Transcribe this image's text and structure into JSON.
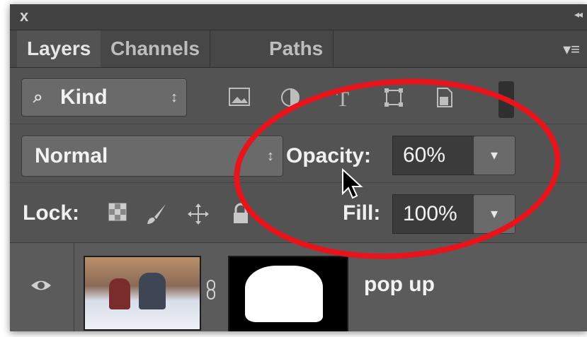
{
  "window": {
    "close_glyph": "x",
    "collapse_glyph": "◂◂"
  },
  "tabs": [
    {
      "label": "Layers",
      "active": true
    },
    {
      "label": "Channels",
      "active": false
    },
    {
      "label": "Paths",
      "active": false
    }
  ],
  "panel_menu_glyph": "▾≡",
  "filter": {
    "label": "Kind",
    "search_glyph": "⌕",
    "arrows": "↕"
  },
  "filter_icons": [
    "pixel-layer-filter-icon",
    "adjustment-layer-filter-icon",
    "type-layer-filter-icon",
    "shape-layer-filter-icon",
    "smart-object-filter-icon"
  ],
  "blend_mode": {
    "value": "Normal"
  },
  "opacity": {
    "label": "Opacity:",
    "value": "60%"
  },
  "lock": {
    "label": "Lock:"
  },
  "fill": {
    "label": "Fill:",
    "value": "100%"
  },
  "layer": {
    "name": "pop up",
    "visible": true
  },
  "annotation_color": "#e8141c"
}
